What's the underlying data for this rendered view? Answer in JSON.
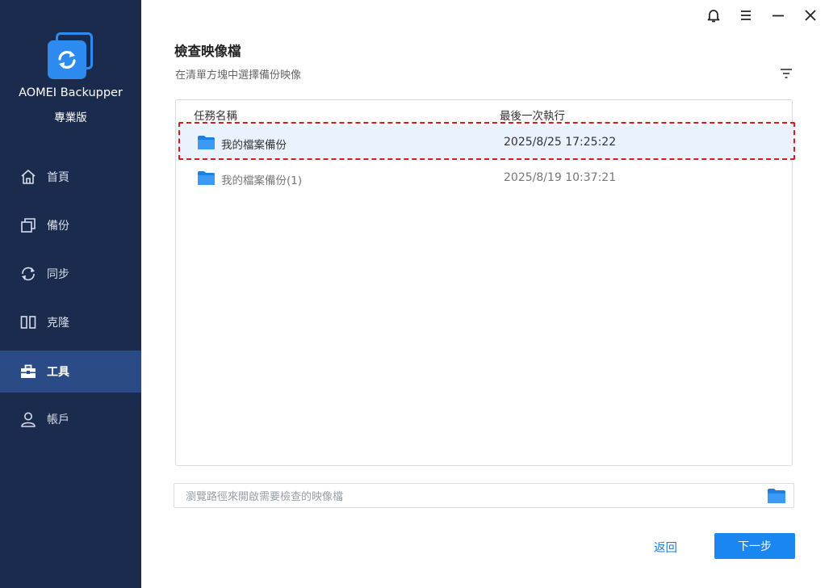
{
  "app": {
    "name": "AOMEI Backupper",
    "edition": "專業版"
  },
  "sidebar": {
    "items": [
      {
        "label": "首頁",
        "icon": "home-icon"
      },
      {
        "label": "備份",
        "icon": "backup-icon"
      },
      {
        "label": "同步",
        "icon": "sync-icon"
      },
      {
        "label": "克隆",
        "icon": "clone-icon"
      },
      {
        "label": "工具",
        "icon": "toolbox-icon",
        "active": true
      },
      {
        "label": "帳戶",
        "icon": "user-icon"
      }
    ]
  },
  "titlebar": {
    "icons": [
      "bell-icon",
      "menu-icon",
      "minimize-icon",
      "close-icon"
    ]
  },
  "main": {
    "title": "檢查映像檔",
    "subtitle": "在清單方塊中選擇備份映像",
    "table": {
      "columns": [
        "任務名稱",
        "最後一次執行"
      ],
      "rows": [
        {
          "name": "我的檔案備份",
          "last_run": "2025/8/25 17:25:22",
          "selected": true
        },
        {
          "name": "我的檔案備份(1)",
          "last_run": "2025/8/19 10:37:21",
          "selected": false
        }
      ]
    },
    "browse": {
      "placeholder": "瀏覽路徑來開啟需要檢查的映像檔"
    },
    "buttons": {
      "back": "返回",
      "next": "下一步"
    }
  },
  "colors": {
    "sidebar_bg": "#1b2b4e",
    "sidebar_active": "#2a4b85",
    "accent": "#1a86f0",
    "highlight": "#d71920"
  }
}
